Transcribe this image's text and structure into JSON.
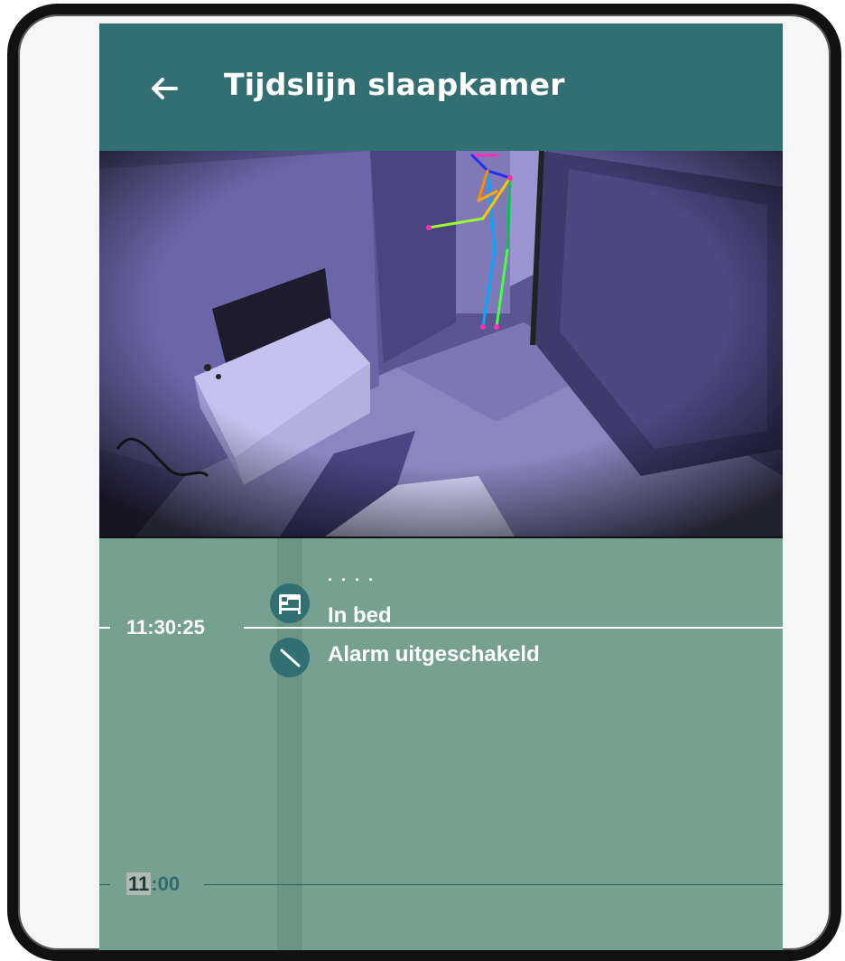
{
  "header": {
    "title": "Tijdslijn slaapkamer",
    "back_icon": "arrow-left-icon",
    "background": "#326f73"
  },
  "camera": {
    "overlay": "pose-skeleton"
  },
  "timeline": {
    "current_time": "11:30:25",
    "hour_label_hour": "11",
    "hour_label_minutes": ":00",
    "background": "#76a08f",
    "events": [
      {
        "label": "In bed",
        "icon": "bed-icon"
      },
      {
        "label": "Alarm uitgeschakeld",
        "icon": "alarm-off-icon"
      }
    ]
  }
}
